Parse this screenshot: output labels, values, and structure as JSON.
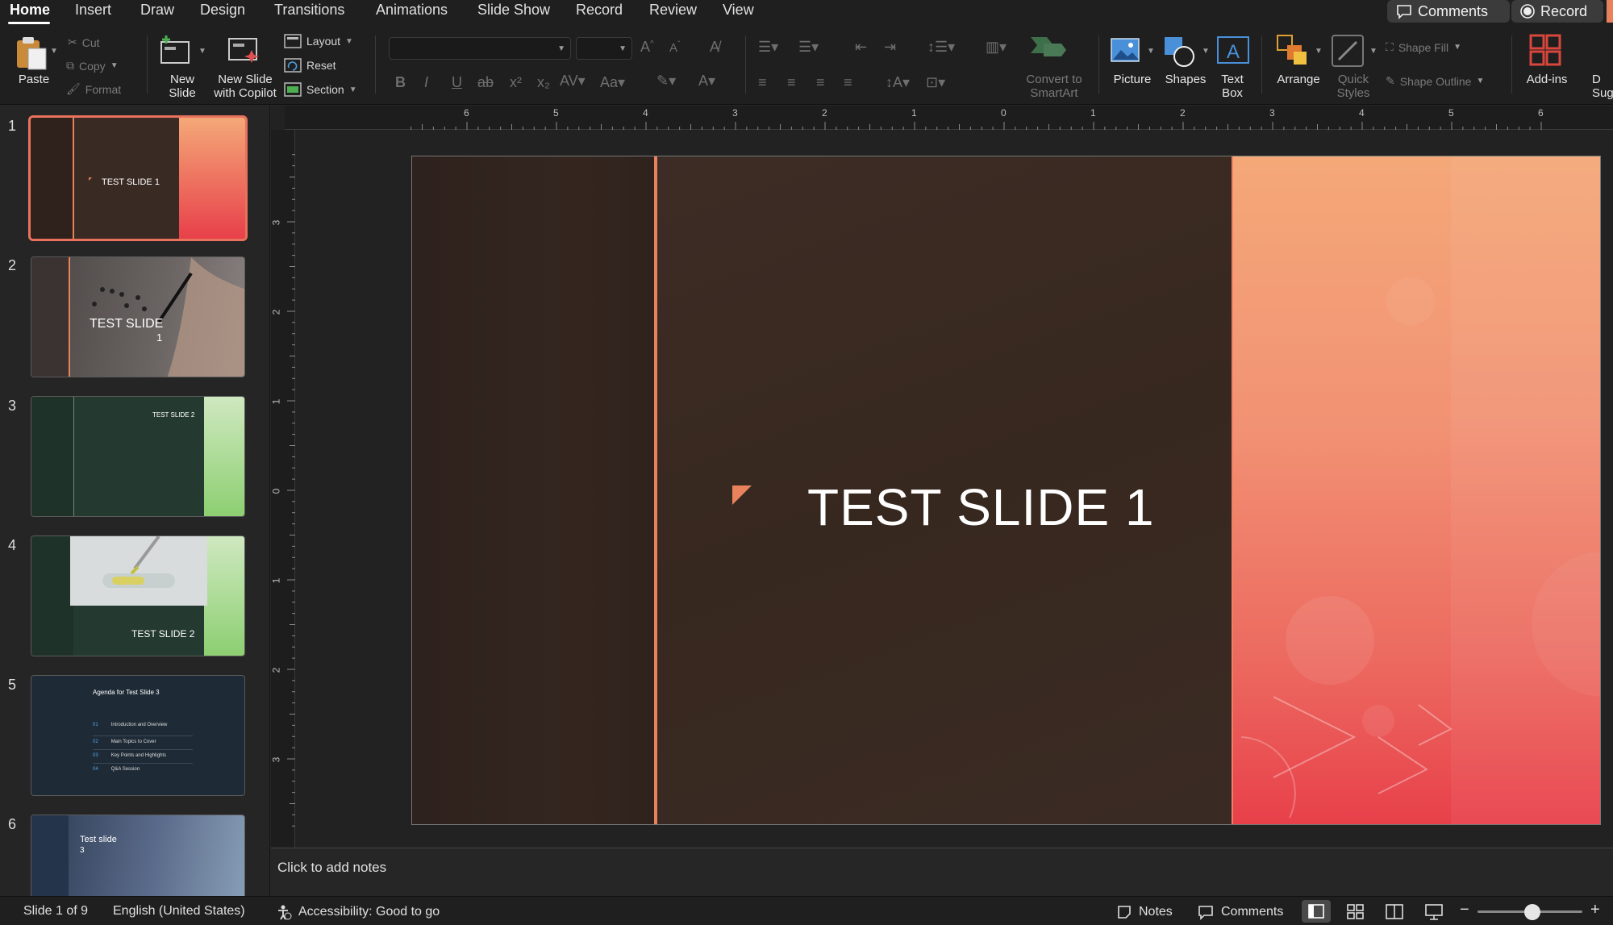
{
  "menu": {
    "tabs": [
      "Home",
      "Insert",
      "Draw",
      "Design",
      "Transitions",
      "Animations",
      "Slide Show",
      "Record",
      "Review",
      "View"
    ],
    "active_tab": "Home",
    "comments_label": "Comments",
    "record_label": "Record"
  },
  "ribbon": {
    "paste": "Paste",
    "cut": "Cut",
    "copy": "Copy",
    "format": "Format",
    "new_slide": "New\nSlide",
    "new_slide_copilot": "New Slide\nwith Copilot",
    "layout": "Layout",
    "reset": "Reset",
    "section": "Section",
    "convert_smartart": "Convert to\nSmartArt",
    "picture": "Picture",
    "shapes": "Shapes",
    "text_box": "Text\nBox",
    "arrange": "Arrange",
    "quick_styles": "Quick\nStyles",
    "shape_fill": "Shape Fill",
    "shape_outline": "Shape Outline",
    "add_ins": "Add-ins",
    "cut_off_label": "D\nSug"
  },
  "ruler": {
    "horizontal": [
      "6",
      "5",
      "4",
      "3",
      "2",
      "1",
      "0",
      "1",
      "2",
      "3",
      "4",
      "5",
      "6"
    ],
    "vertical": [
      "3",
      "2",
      "1",
      "0",
      "1",
      "2",
      "3"
    ]
  },
  "thumbnails": [
    {
      "number": "1",
      "title": "TEST SLIDE 1",
      "selected": true
    },
    {
      "number": "2",
      "title": "TEST SLIDE",
      "subtitle": "1"
    },
    {
      "number": "3",
      "title": "TEST SLIDE 2"
    },
    {
      "number": "4",
      "title": "TEST SLIDE 2"
    },
    {
      "number": "5",
      "title": "Agenda for Test Slide 3",
      "agenda": [
        {
          "num": "01",
          "text": "Introduction and Overview"
        },
        {
          "num": "02",
          "text": "Main Topics to Cover"
        },
        {
          "num": "03",
          "text": "Key Points and Highlights"
        },
        {
          "num": "04",
          "text": "Q&A Session"
        }
      ]
    },
    {
      "number": "6",
      "title": "Test slide",
      "subtitle": "3"
    }
  ],
  "slide": {
    "title": "TEST SLIDE 1"
  },
  "notes_placeholder": "Click to add notes",
  "status": {
    "slide_counter": "Slide 1 of 9",
    "language": "English (United States)",
    "accessibility": "Accessibility: Good to go",
    "notes": "Notes",
    "comments": "Comments",
    "zoom_fraction": 0.52
  },
  "colors": {
    "accent_orange": "#e8825c",
    "slide_bg": "#3a2a24",
    "gradient_top": "#f4a878",
    "gradient_bottom": "#e8404a",
    "selection_border": "#e8725c"
  }
}
